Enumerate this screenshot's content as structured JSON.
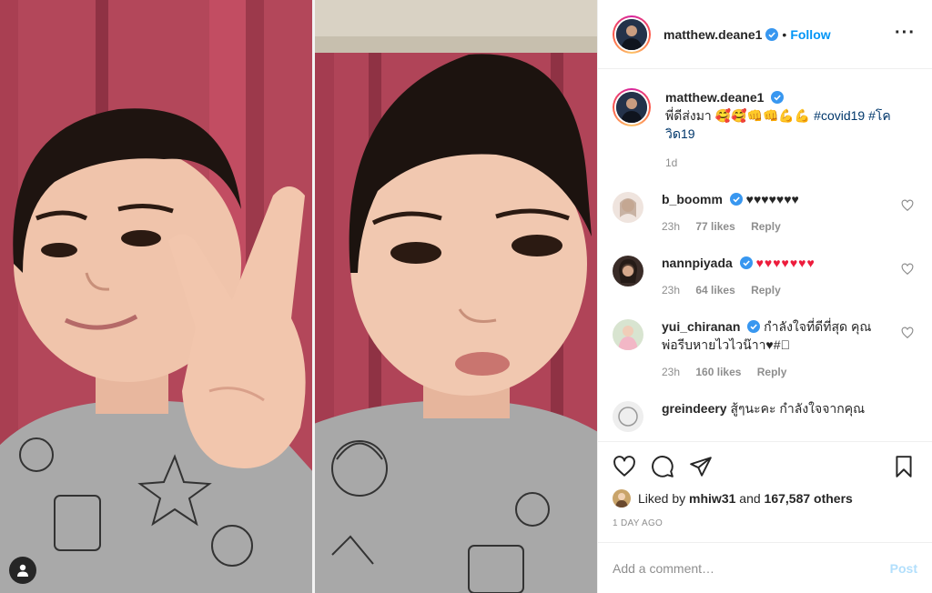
{
  "header": {
    "username": "matthew.deane1",
    "separator": "•",
    "follow_label": "Follow",
    "more_label": "···"
  },
  "caption": {
    "username": "matthew.deane1",
    "text": "พี่ดีส่งมา 🥰🥰👊👊💪💪",
    "hashtags": "#covid19 #โควิด19",
    "time": "1d"
  },
  "comments": [
    {
      "username": "b_boomm",
      "text": "♥♥♥♥♥♥♥",
      "time": "23h",
      "likes": "77 likes",
      "reply": "Reply"
    },
    {
      "username": "nannpiyada",
      "text": "♥♥♥♥♥♥♥",
      "time": "23h",
      "likes": "64 likes",
      "reply": "Reply"
    },
    {
      "username": "yui_chiranan",
      "text": "กำลังใจที่ดีที่สุด คุณพ่อรีบหายไวไวน๊าา♥#🏻",
      "time": "23h",
      "likes": "160 likes",
      "reply": "Reply"
    },
    {
      "username": "greindeery",
      "text": "สู้ๆนะคะ กำลังใจจากคุณ"
    }
  ],
  "likes": {
    "prefix": "Liked by",
    "user": "mhiw31",
    "and": "and",
    "others": "167,587 others"
  },
  "post_age": "1 DAY AGO",
  "add_comment": {
    "placeholder": "Add a comment…",
    "post_label": "Post"
  },
  "colors": {
    "link_blue": "#0095f6",
    "post_disabled": "#b2dffc",
    "heart_red": "#ed1c3c",
    "muted": "#8e8e8e"
  },
  "icons": [
    "heart-icon",
    "comment-icon",
    "share-icon",
    "bookmark-icon",
    "verified-icon",
    "user-tag-icon",
    "more-icon"
  ]
}
